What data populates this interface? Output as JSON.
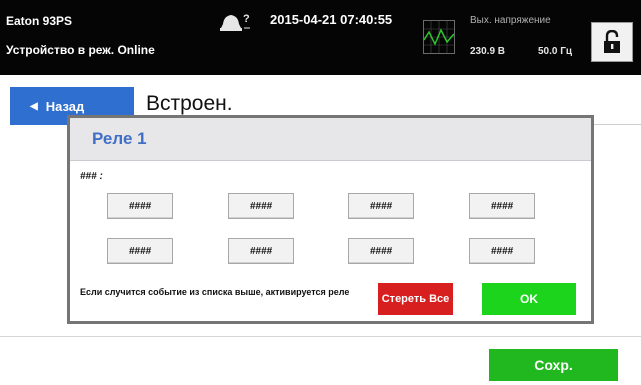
{
  "header": {
    "device_name": "Eaton 93PS",
    "device_mode": "Устройство в реж. Online",
    "datetime": "2015-04-21 07:40:55",
    "output_label": "Вых. напряжение",
    "output_voltage": "230.9 В",
    "output_frequency": "50.0 Гц"
  },
  "nav": {
    "back_label": "Назад",
    "page_title": "Встроен."
  },
  "dialog": {
    "title": "Реле 1",
    "field_label": "### :",
    "relay_buttons": [
      "####",
      "####",
      "####",
      "####",
      "####",
      "####",
      "####",
      "####"
    ],
    "note": "Если случится событие из списка выше, активируется реле",
    "clear_label": "Стереть Все",
    "ok_label": "OK"
  },
  "footer": {
    "save_label": "Сохр."
  },
  "colors": {
    "header_bg": "#050505",
    "back_button": "#2f6fcf",
    "dialog_title": "#3f6fc6",
    "clear_button": "#d71f1f",
    "ok_button": "#1bd41b",
    "save_button": "#21b81f"
  },
  "icons": {
    "alarm": "alarm-bell-icon",
    "waveform": "waveform-icon",
    "lock": "unlock-icon",
    "back_arrow": "triangle-left-icon"
  }
}
